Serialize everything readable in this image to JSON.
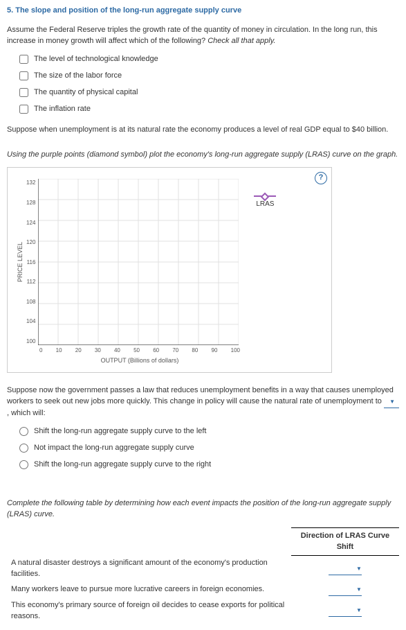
{
  "title": "5. The slope and position of the long-run aggregate supply curve",
  "q1": {
    "prompt_a": "Assume the Federal Reserve triples the growth rate of the quantity of money in circulation. In the long run, this increase in money growth will affect which of the following? ",
    "prompt_b": "Check all that apply.",
    "options": [
      "The level of technological knowledge",
      "The size of the labor force",
      "The quantity of physical capital",
      "The inflation rate"
    ]
  },
  "q2": "Suppose when unemployment is at its natural rate the economy produces a level of real GDP equal to $40 billion.",
  "q3_instr": "Using the purple points (diamond symbol) plot the economy's long-run aggregate supply (LRAS) curve on the graph.",
  "help_icon": "?",
  "graph": {
    "ylabel": "PRICE LEVEL",
    "xlabel": "OUTPUT (Billions of dollars)",
    "yticks": [
      "132",
      "128",
      "124",
      "120",
      "116",
      "112",
      "108",
      "104",
      "100"
    ],
    "xticks": [
      "0",
      "10",
      "20",
      "30",
      "40",
      "50",
      "60",
      "70",
      "80",
      "90",
      "100"
    ],
    "legend": "LRAS"
  },
  "q4": {
    "prompt_a": "Suppose now the government passes a law that reduces unemployment benefits in a way that causes unemployed workers to seek out new jobs more quickly. This change in policy will cause the natural rate of unemployment to ",
    "prompt_b": " , which will:",
    "options": [
      "Shift the long-run aggregate supply curve to the left",
      "Not impact the long-run aggregate supply curve",
      "Shift the long-run aggregate supply curve to the right"
    ]
  },
  "q5": {
    "instr": "Complete the following table by determining how each event impacts the position of the long-run aggregate supply (LRAS) curve.",
    "col_header": "Direction of LRAS Curve Shift",
    "rows": [
      "A natural disaster destroys a significant amount of the economy's production facilities.",
      "Many workers leave to pursue more lucrative careers in foreign economies.",
      "This economy's primary source of foreign oil decides to cease exports for political reasons."
    ]
  },
  "chart_data": {
    "type": "line",
    "title": "",
    "xlabel": "OUTPUT (Billions of dollars)",
    "ylabel": "PRICE LEVEL",
    "xlim": [
      0,
      100
    ],
    "ylim": [
      100,
      132
    ],
    "series": [],
    "note": "Empty grid; user will plot vertical LRAS curve at x=40 using purple diamond points via the legend palette tool."
  }
}
